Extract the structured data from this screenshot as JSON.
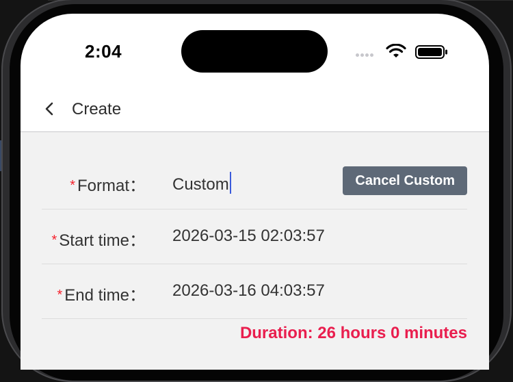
{
  "status_bar": {
    "time": "2:04"
  },
  "navbar": {
    "title": "Create"
  },
  "form": {
    "required_mark": "*",
    "format": {
      "label": "Format：",
      "value": "Custom",
      "cancel_button": "Cancel Custom"
    },
    "start_time": {
      "label": "Start time：",
      "value": "2026-03-15 02:03:57"
    },
    "end_time": {
      "label": "End time：",
      "value": "2026-03-16 04:03:57"
    },
    "duration": "Duration: 26 hours 0 minutes"
  },
  "colors": {
    "required": "#f5222d",
    "duration": "#e91e4e",
    "button_bg": "#5e6977",
    "cursor": "#3b5bdb"
  },
  "icons": {
    "back": "chevron-left-icon",
    "signal": "cellular-signal-icon",
    "wifi": "wifi-icon",
    "battery": "battery-icon"
  }
}
